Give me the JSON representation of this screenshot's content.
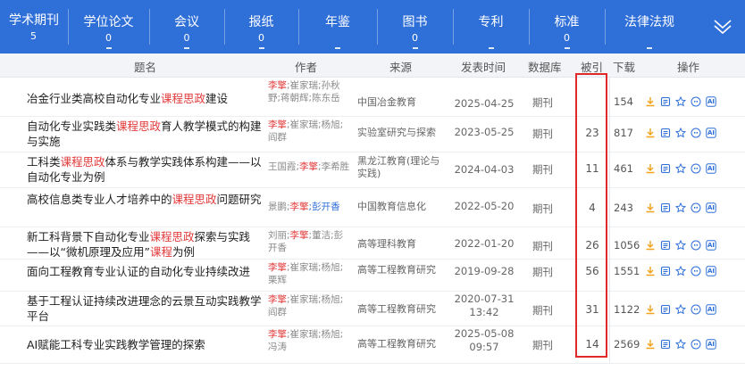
{
  "tabs": [
    {
      "label": "学术期刊",
      "count": "5"
    },
    {
      "label": "学位论文",
      "count": "0"
    },
    {
      "label": "会议",
      "count": "0"
    },
    {
      "label": "报纸",
      "count": "0"
    },
    {
      "label": "年鉴",
      "count": ""
    },
    {
      "label": "图书",
      "count": "0"
    },
    {
      "label": "专利",
      "count": ""
    },
    {
      "label": "标准",
      "count": "0"
    },
    {
      "label": "法律法规",
      "count": ""
    }
  ],
  "columns": {
    "title": "题名",
    "author": "作者",
    "source": "来源",
    "date": "发表时间",
    "database": "数据库",
    "cited": "被引",
    "downloads": "下载",
    "actions": "操作"
  },
  "rows": [
    {
      "title": [
        {
          "t": "冶金行业类高校自动化专业",
          "hl": false
        },
        {
          "t": "课程思政",
          "hl": true
        },
        {
          "t": "建设",
          "hl": false
        }
      ],
      "authors": [
        {
          "t": "李擎",
          "c": "hl"
        },
        {
          "t": ";崔家瑞;孙秋野;蒋朝辉;陈东岳",
          "c": ""
        }
      ],
      "source": "中国冶金教育",
      "date": "2025-04-25",
      "db": "期刊",
      "cited": "",
      "downloads": "154"
    },
    {
      "title": [
        {
          "t": "自动化专业实践类",
          "hl": false
        },
        {
          "t": "课程思政",
          "hl": true
        },
        {
          "t": "育人教学模式的构建与实施",
          "hl": false
        }
      ],
      "authors": [
        {
          "t": "李擎",
          "c": "hl"
        },
        {
          "t": ";崔家瑞;杨旭;阎群",
          "c": ""
        }
      ],
      "source": "实验室研究与探索",
      "date": "2023-05-25",
      "db": "期刊",
      "cited": "23",
      "downloads": "817"
    },
    {
      "title": [
        {
          "t": "工科类",
          "hl": false
        },
        {
          "t": "课程思政",
          "hl": true
        },
        {
          "t": "体系与教学实践体系构建——以自动化专业为例",
          "hl": false
        }
      ],
      "authors": [
        {
          "t": "王国霞;",
          "c": ""
        },
        {
          "t": "李擎",
          "c": "hl"
        },
        {
          "t": ";李希胜",
          "c": ""
        }
      ],
      "source": "黑龙江教育(理论与实践)",
      "date": "2024-04-03",
      "db": "期刊",
      "cited": "11",
      "downloads": "461"
    },
    {
      "title": [
        {
          "t": "高校信息类专业人才培养中的",
          "hl": false
        },
        {
          "t": "课程思政",
          "hl": true
        },
        {
          "t": "问题研究",
          "hl": false
        }
      ],
      "authors": [
        {
          "t": "景鹏;",
          "c": ""
        },
        {
          "t": "李擎",
          "c": "hl"
        },
        {
          "t": ";彭开香",
          "c": "bl"
        }
      ],
      "source": "中国教育信息化",
      "date": "2022-05-20",
      "db": "期刊",
      "cited": "4",
      "downloads": "243"
    },
    {
      "title": [
        {
          "t": "新工科背景下自动化专业",
          "hl": false
        },
        {
          "t": "课程思政",
          "hl": true
        },
        {
          "t": "探索与实践——以“微机原理及应用”",
          "hl": false
        },
        {
          "t": "课程",
          "hl": true
        },
        {
          "t": "为例",
          "hl": false
        }
      ],
      "authors": [
        {
          "t": "刘丽;",
          "c": ""
        },
        {
          "t": "李擎",
          "c": "hl"
        },
        {
          "t": ";董洁;彭开香",
          "c": ""
        }
      ],
      "source": "高等理科教育",
      "date": "2022-01-20",
      "db": "期刊",
      "cited": "26",
      "downloads": "1056"
    },
    {
      "title": [
        {
          "t": "面向工程教育专业认证的自动化专业持续改进",
          "hl": false
        }
      ],
      "authors": [
        {
          "t": "李擎",
          "c": "hl"
        },
        {
          "t": ";崔家瑞;杨旭;栗辉",
          "c": ""
        }
      ],
      "source": "高等工程教育研究",
      "date": "2019-09-28",
      "db": "期刊",
      "cited": "56",
      "downloads": "1551"
    },
    {
      "title": [
        {
          "t": "基于工程认证持续改进理念的云景互动实践教学平台",
          "hl": false
        }
      ],
      "authors": [
        {
          "t": "李擎",
          "c": "hl"
        },
        {
          "t": ";崔家瑞;杨旭;阎群",
          "c": ""
        }
      ],
      "source": "高等工程教育研究",
      "date": "2020-07-31 13:42",
      "db": "期刊",
      "cited": "31",
      "downloads": "1122"
    },
    {
      "title": [
        {
          "t": "AI赋能工科专业实践教学管理的探索",
          "hl": false
        }
      ],
      "authors": [
        {
          "t": "李擎",
          "c": "hl"
        },
        {
          "t": ";崔家瑞;杨旭;冯涛",
          "c": ""
        }
      ],
      "source": "高等工程教育研究",
      "date": "2025-05-08 09:57",
      "db": "期刊",
      "cited": "14",
      "downloads": "2569"
    }
  ],
  "ops_icons": [
    "download-icon",
    "read-icon",
    "favorite-icon",
    "quote-icon",
    "ai-icon"
  ],
  "ops_ai_label": "AI",
  "colors": {
    "tab_bg": "#2f6fd8",
    "highlight": "#e23b3b",
    "link": "#2f6fd8",
    "icon_download": "#f0a21c",
    "icon_ops": "#2f6fd8",
    "redbox": "#e02a2a"
  }
}
